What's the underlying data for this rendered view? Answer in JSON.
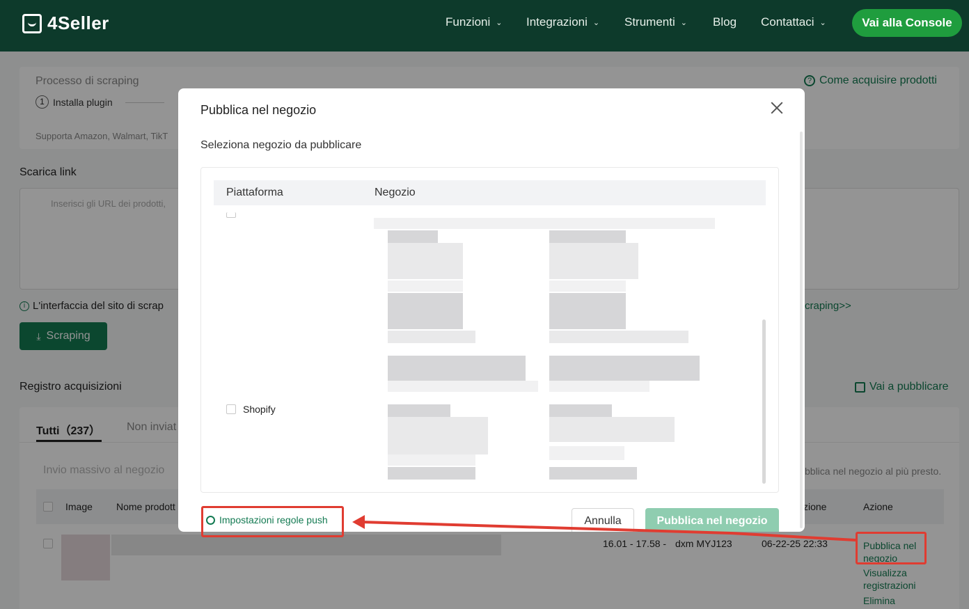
{
  "header": {
    "brand": "4Seller",
    "nav": [
      {
        "label": "Funzioni",
        "has_menu": true
      },
      {
        "label": "Integrazioni",
        "has_menu": true
      },
      {
        "label": "Strumenti",
        "has_menu": true
      },
      {
        "label": "Blog",
        "has_menu": false
      },
      {
        "label": "Contattaci",
        "has_menu": true
      }
    ],
    "console_button": "Vai alla Console"
  },
  "page": {
    "process_title": "Processo di scraping",
    "how_to_link": "Come acquisire prodotti",
    "step1": "Installa plugin",
    "step1_num": "1",
    "supports": "Supporta Amazon, Walmart, TikT",
    "download_title": "Scarica link",
    "url_placeholder": "Inserisci gli URL dei prodotti,",
    "info_text": "L'interfaccia del sito di scrap",
    "info_link": "craping>>",
    "scraping_button": "Scraping",
    "log_title": "Registro acquisizioni",
    "go_publish": "Vai a pubblicare",
    "tab_all": "Tutti（237）",
    "tab_not_sent": "Non inviat",
    "bulk_send": "Invio massivo al negozio",
    "notice_tail": "bblica nel negozio al più presto.",
    "columns": {
      "image": "Image",
      "name": "Nome prodott",
      "zione": "zione",
      "action": "Azione"
    },
    "row": {
      "time": "16.01 - 17.58 -",
      "user": "dxm MYJ123",
      "date": "06-22-25 22:33",
      "actions": [
        "Pubblica nel negozio",
        "Visualizza registrazioni",
        "Elimina"
      ]
    }
  },
  "modal": {
    "title": "Pubblica nel negozio",
    "subtitle": "Seleziona negozio da pubblicare",
    "col_platform": "Piattaforma",
    "col_store": "Negozio",
    "platform_shopify": "Shopify",
    "push_rules": "Impostazioni regole push",
    "cancel": "Annulla",
    "publish": "Pubblica nel negozio"
  },
  "colors": {
    "header_bg": "#0d3a2b",
    "accent": "#137a52",
    "console_btn": "#1f9d3e",
    "annotation": "#e03c31"
  }
}
